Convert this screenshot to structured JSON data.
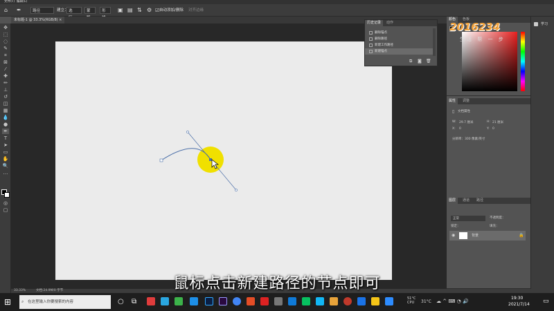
{
  "menubar": {
    "items": [
      "文件(F)",
      "编辑(E)"
    ]
  },
  "options_bar": {
    "mode_label": "路径",
    "build_label": "建立：",
    "selection_btn": "选区...",
    "mask_btn": "蒙版",
    "shape_btn": "形状",
    "auto_add_delete": "自动添加/删除",
    "align_edges": "对齐边缘"
  },
  "document_tab": {
    "title": "未标题-1 @ 33.3%(RGB/8) ×"
  },
  "history_panel": {
    "tabs": [
      "历史记录",
      "动作"
    ],
    "items": [
      {
        "label": "删除锚点",
        "selected": false
      },
      {
        "label": "删除路径",
        "selected": false
      },
      {
        "label": "新建工作路径",
        "selected": false
      },
      {
        "label": "新建锚点",
        "selected": true
      }
    ]
  },
  "color_panel": {
    "tabs": [
      "颜色",
      "色板"
    ]
  },
  "properties_panel": {
    "tabs": [
      "属性",
      "调整"
    ],
    "doc_props": "文档属性",
    "w_label": "W:",
    "w_value": "29.7 厘米",
    "h_label": "H:",
    "h_value": "21 厘米",
    "x_label": "X:",
    "x_value": "0",
    "y_label": "Y:",
    "y_value": "0",
    "resolution": "分辨率：300 像素/英寸"
  },
  "layers_panel": {
    "tabs": [
      "图层",
      "通道",
      "路径"
    ],
    "kind_label": "正常",
    "opacity_label": "不透明度：",
    "lock_label": "锁定：",
    "fill_label": "填充：",
    "layer_name": "背景"
  },
  "right_strip": {
    "learn_label": "学习"
  },
  "logo": {
    "text": "2016234",
    "sub": "生活 帮 一 步"
  },
  "status_bar": {
    "zoom": "33.33%",
    "doc_size": "文档:24.9M/0 字节"
  },
  "subtitle": "鼠标点击新建路径的节点即可",
  "taskbar": {
    "search_placeholder": "在这里输入你要搜索的内容",
    "weather_temp": "31°C",
    "cpu_label": "51°C CPU",
    "time": "19:30",
    "date": "2021/7/14"
  },
  "colors": {
    "accent": "#f0e000",
    "path": "#4a6ea8",
    "canvas": "#ebebeb"
  }
}
